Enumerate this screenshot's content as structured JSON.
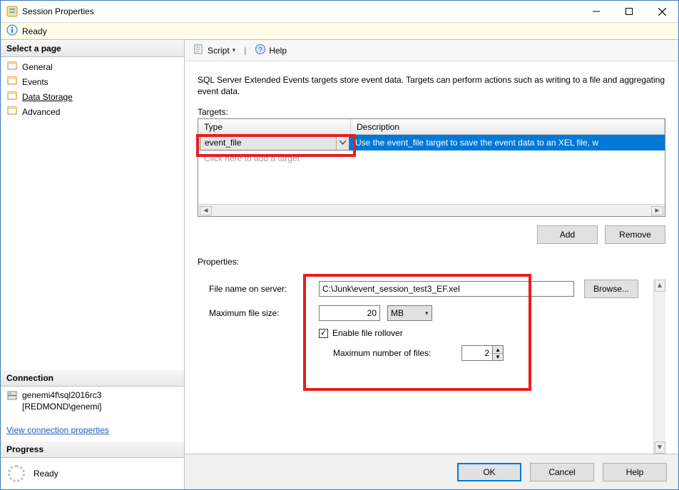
{
  "window": {
    "title": "Session Properties"
  },
  "status": {
    "text": "Ready"
  },
  "left": {
    "select_page_header": "Select a page",
    "pages": [
      {
        "label": "General"
      },
      {
        "label": "Events"
      },
      {
        "label": "Data Storage"
      },
      {
        "label": "Advanced"
      }
    ],
    "connection_header": "Connection",
    "connection_line1": "genemi4f\\sql2016rc3",
    "connection_line2": "[REDMOND\\genemi]",
    "view_connection": "View connection properties",
    "progress_header": "Progress",
    "progress_text": "Ready"
  },
  "toolbar": {
    "script_label": "Script",
    "help_label": "Help"
  },
  "main": {
    "intro": "SQL Server Extended Events targets store event data. Targets can perform actions such as writing to a file and aggregating event data.",
    "targets_label": "Targets:",
    "columns": {
      "type": "Type",
      "description": "Description"
    },
    "selected_target_type": "event_file",
    "selected_target_desc": "Use the event_file target to save the event data to an XEL file, w",
    "add_target_placeholder": "Click here to add a target",
    "buttons": {
      "add": "Add",
      "remove": "Remove"
    },
    "properties_label": "Properties:",
    "form": {
      "file_label": "File name on server:",
      "file_value": "C:\\Junk\\event_session_test3_EF.xel",
      "browse": "Browse...",
      "maxsize_label": "Maximum file size:",
      "maxsize_value": "20",
      "maxsize_unit": "MB",
      "rollover_label": "Enable file rollover",
      "maxfiles_label": "Maximum number of files:",
      "maxfiles_value": "2"
    }
  },
  "footer": {
    "ok": "OK",
    "cancel": "Cancel",
    "help": "Help"
  }
}
